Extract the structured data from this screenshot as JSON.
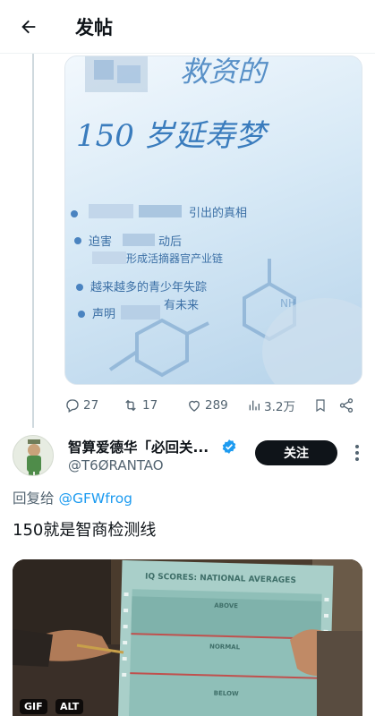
{
  "header": {
    "title": "发帖"
  },
  "tweet1": {
    "image_text": {
      "title_line1": "救资的",
      "title_line2": "150 岁延寿梦",
      "bullets": [
        "引出的真相",
        "迫害",
        "形成活摘器官产业链",
        "越来越多的青少年失踪",
        "声明",
        "有未来"
      ]
    },
    "actions": {
      "replies": "27",
      "retweets": "17",
      "likes": "289",
      "views": "3.2万"
    }
  },
  "tweet2": {
    "display_name": "智算爱德华「必回关...",
    "handle": "@T6ØRANTAO",
    "follow_label": "关注",
    "reply_prefix": "回复给",
    "reply_handle": "@GFWfrog",
    "text": "150就是智商检测线",
    "media": {
      "sheet_title": "IQ SCORES: NATIONAL AVERAGES",
      "above": "ABOVE",
      "normal": "NORMAL",
      "below": "BELOW",
      "badge_gif": "GIF",
      "badge_alt": "ALT"
    }
  },
  "colors": {
    "accent": "#1d9bf0",
    "text": "#0f1419",
    "muted": "#536471",
    "button": "#0f1419"
  },
  "icons": [
    "back-arrow-icon",
    "reply-icon",
    "retweet-icon",
    "like-icon",
    "views-icon",
    "bookmark-icon",
    "share-icon",
    "verified-icon",
    "more-icon"
  ]
}
